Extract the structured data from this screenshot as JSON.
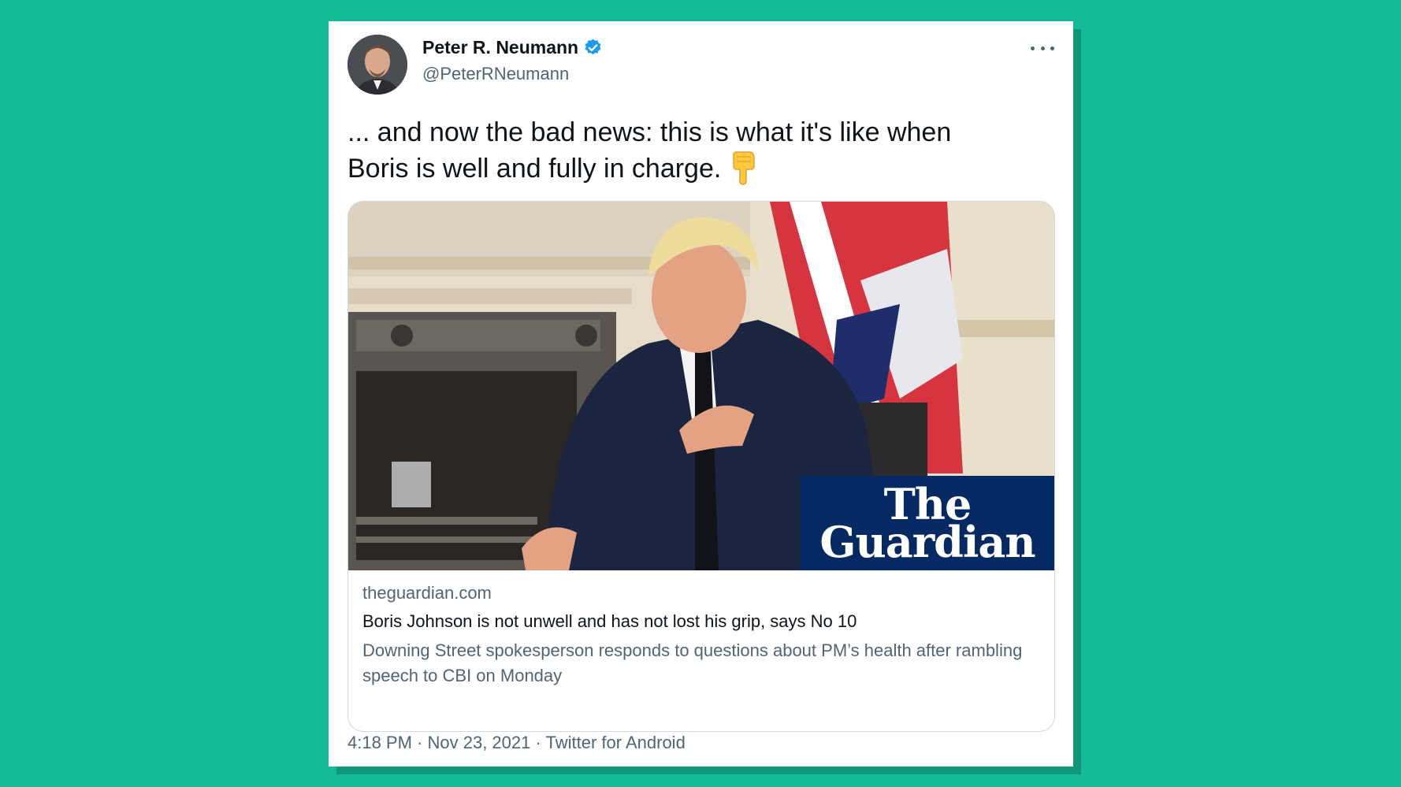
{
  "author": {
    "name": "Peter R. Neumann",
    "handle": "@PeterRNeumann",
    "verified": true
  },
  "tweet": {
    "text_line1": "... and now the bad news: this is what it's like when",
    "text_line2": "Boris is well and fully in charge.",
    "emoji": "backhand-index-pointing-down"
  },
  "link_card": {
    "brand_line1": "The",
    "brand_line2": "Guardian",
    "domain": "theguardian.com",
    "headline": "Boris Johnson is not unwell and has not lost his grip, says No 10",
    "description": "Downing Street spokesperson responds to questions about PM’s health after rambling speech to CBI on Monday"
  },
  "meta": {
    "timestamp": "4:18 PM · Nov 23, 2021 · Twitter for Android"
  },
  "colors": {
    "background": "#14b995",
    "verified": "#1d9bf0",
    "guardian": "#052962",
    "secondary_text": "#536471"
  }
}
